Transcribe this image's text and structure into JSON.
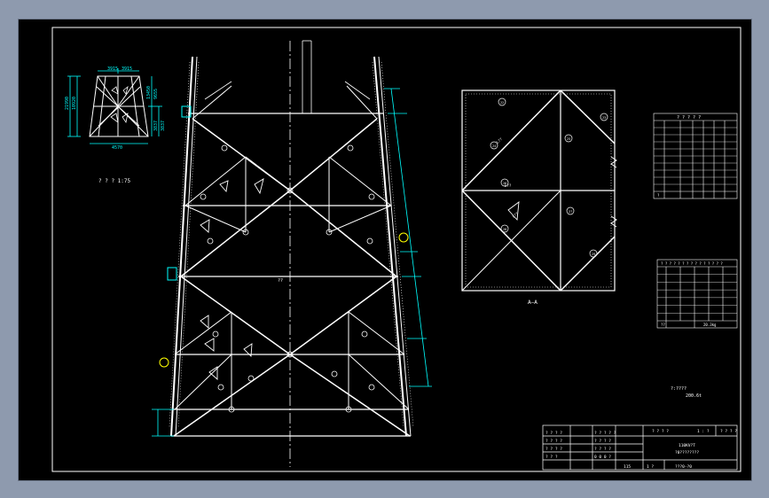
{
  "colors": {
    "background": "#8e9aae",
    "canvas": "#000000",
    "line": "#ffffff",
    "dimension": "#00ffff",
    "highlight": "#ffff00"
  },
  "small_view": {
    "dims_top": [
      "3915",
      "3915"
    ],
    "dims_left": [
      "21990",
      "10920"
    ],
    "dims_right": [
      "13450",
      "9655",
      "3837",
      "3837"
    ],
    "dim_bottom": "4570",
    "caption": "? ? ? 1:75"
  },
  "main_view": {
    "center_label": "??"
  },
  "section_view": {
    "caption": "A—A",
    "callouts": [
      "22",
      "23",
      "24",
      "25",
      "26",
      "27",
      "28",
      "29"
    ],
    "part_labels": [
      "L??",
      "L??",
      "L??"
    ]
  },
  "table1": {
    "title": "? ? ? ? ?",
    "row_count": 10,
    "footer": "?"
  },
  "table2": {
    "title": "? ? ? ? ? ? ? ? ? ? ? ? ? ? ?",
    "row_count": 7,
    "footer_left": "??",
    "footer_right": "20.3kg"
  },
  "notes": {
    "line1": "?:????",
    "line2": "200.6t"
  },
  "title_block": {
    "left_rows": [
      "? ? ? ?",
      "? ? ? ?",
      "? ? ? ?",
      "? ? ?"
    ],
    "mid_rows": [
      "? ? ? ? ?",
      "? ? ? ?",
      "? ? ? ?",
      "0 0 0 ?"
    ],
    "project_label": "? ? ? ?",
    "ratio": "1 : ?",
    "sheet": "? ?\n? ?",
    "drawing_name": "110KV?T",
    "drawing_sub": "?0????????",
    "scale_label": "115",
    "sheet_no": "1  ?",
    "drawing_no": "???0-?0"
  }
}
